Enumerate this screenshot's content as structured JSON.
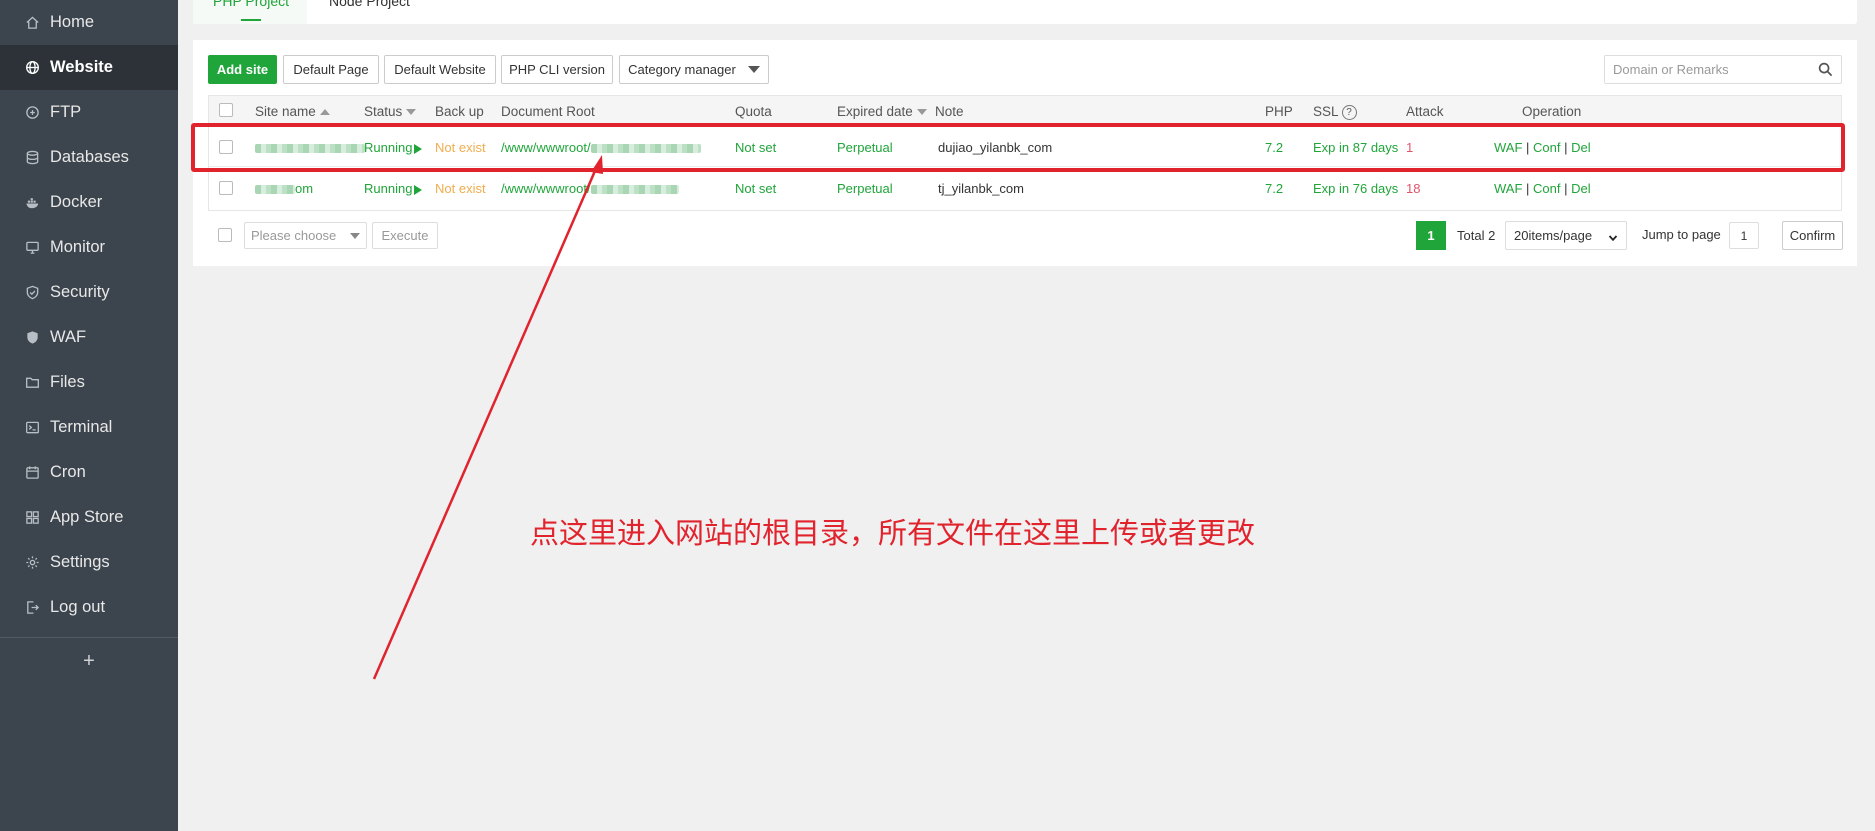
{
  "sidebar": {
    "items": [
      {
        "label": "Home",
        "icon": "home-icon",
        "active": false
      },
      {
        "label": "Website",
        "icon": "globe-icon",
        "active": true
      },
      {
        "label": "FTP",
        "icon": "ftp-icon",
        "active": false
      },
      {
        "label": "Databases",
        "icon": "database-icon",
        "active": false
      },
      {
        "label": "Docker",
        "icon": "docker-icon",
        "active": false
      },
      {
        "label": "Monitor",
        "icon": "monitor-icon",
        "active": false
      },
      {
        "label": "Security",
        "icon": "shield-icon",
        "active": false
      },
      {
        "label": "WAF",
        "icon": "waf-shield-icon",
        "active": false
      },
      {
        "label": "Files",
        "icon": "folder-icon",
        "active": false
      },
      {
        "label": "Terminal",
        "icon": "terminal-icon",
        "active": false
      },
      {
        "label": "Cron",
        "icon": "calendar-icon",
        "active": false
      },
      {
        "label": "App Store",
        "icon": "grid-icon",
        "active": false
      },
      {
        "label": "Settings",
        "icon": "gear-icon",
        "active": false
      },
      {
        "label": "Log out",
        "icon": "logout-icon",
        "active": false
      }
    ],
    "add_label": "+"
  },
  "tabs": {
    "active": "PHP Project",
    "inactive": "Node Project"
  },
  "toolbar": {
    "add_site": "Add site",
    "default_page": "Default Page",
    "default_website": "Default Website",
    "php_cli": "PHP CLI version",
    "category_manager": "Category manager",
    "search_placeholder": "Domain or Remarks"
  },
  "table": {
    "headers": {
      "site_name": "Site name",
      "status": "Status",
      "backup": "Back up",
      "doc_root": "Document Root",
      "quota": "Quota",
      "expired": "Expired date",
      "note": "Note",
      "php": "PHP",
      "ssl": "SSL",
      "ssl_help": "?",
      "attack": "Attack",
      "operation": "Operation"
    },
    "rows": [
      {
        "site_suffix": "",
        "status": "Running",
        "backup": "Not exist",
        "doc_root": "/www/wwwroot/",
        "quota": "Not set",
        "expired": "Perpetual",
        "note": "dujiao_yilanbk_com",
        "php": "7.2",
        "ssl": "Exp in 87 days",
        "attack": "1",
        "ops": {
          "waf": "WAF",
          "conf": "Conf",
          "del": "Del",
          "sep": "|"
        }
      },
      {
        "site_suffix": "om",
        "status": "Running",
        "backup": "Not exist",
        "doc_root": "/www/wwwroot/",
        "quota": "Not set",
        "expired": "Perpetual",
        "note": "tj_yilanbk_com",
        "php": "7.2",
        "ssl": "Exp in 76 days",
        "attack": "18",
        "ops": {
          "waf": "WAF",
          "conf": "Conf",
          "del": "Del",
          "sep": "|"
        }
      }
    ]
  },
  "footer": {
    "batch_placeholder": "Please choose",
    "execute": "Execute",
    "current_page": "1",
    "total": "Total 2",
    "per_page": "20items/page",
    "jump_label": "Jump to page",
    "jump_value": "1",
    "confirm": "Confirm"
  },
  "annotation": {
    "text": "点这里进入网站的根目录，所有文件在这里上传或者更改",
    "color": "#e0232d"
  },
  "colors": {
    "accent": "#20a53a",
    "sidebar_bg": "#3c444d",
    "warning": "#f0ad4e",
    "danger": "#e0556b"
  }
}
